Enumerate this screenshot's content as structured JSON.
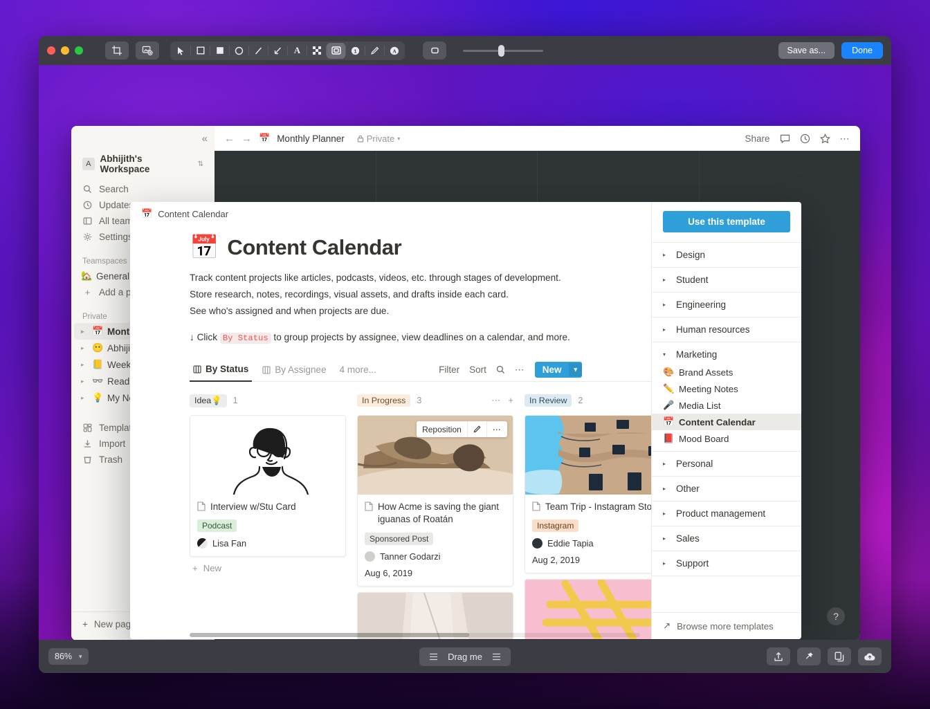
{
  "editor": {
    "toolbar": {
      "crop_label": "crop-tool",
      "annotate_label": "image-annotate-tool",
      "tools": [
        {
          "name": "cursor-tool",
          "glyph": "cursor"
        },
        {
          "name": "rectangle-outline-tool",
          "glyph": "rect-outline"
        },
        {
          "name": "rectangle-filled-tool",
          "glyph": "rect-filled"
        },
        {
          "name": "ellipse-tool",
          "glyph": "ellipse"
        },
        {
          "name": "line-tool",
          "glyph": "line"
        },
        {
          "name": "arrow-tool",
          "glyph": "arrow"
        },
        {
          "name": "text-tool",
          "glyph": "A"
        },
        {
          "name": "pixelate-tool",
          "glyph": "pixelate"
        },
        {
          "name": "shadow-tool",
          "glyph": "shadow"
        },
        {
          "name": "counter-tool",
          "glyph": "1"
        },
        {
          "name": "highlighter-tool",
          "glyph": "pen"
        },
        {
          "name": "blur-text-tool",
          "glyph": "blurA"
        }
      ],
      "shape_style_label": "shape-style",
      "save_as_label": "Save as...",
      "done_label": "Done"
    },
    "bottom": {
      "zoom_level": "86%",
      "drag_label": "Drag me",
      "actions": [
        {
          "name": "share-button",
          "glyph": "share"
        },
        {
          "name": "pin-button",
          "glyph": "pin"
        },
        {
          "name": "copy-button",
          "glyph": "copy"
        },
        {
          "name": "upload-cloud-button",
          "glyph": "cloud"
        }
      ]
    }
  },
  "notion": {
    "sidebar": {
      "workspace": {
        "badge": "A",
        "name": "Abhijith's Workspace"
      },
      "items": [
        {
          "icon": "search-icon",
          "label": "Search"
        },
        {
          "icon": "updates-icon",
          "label": "Updates"
        },
        {
          "icon": "all-teams-icon",
          "label": "All teams"
        },
        {
          "icon": "settings-icon",
          "label": "Settings"
        }
      ],
      "teamspaces_label": "Teamspaces",
      "teamspaces": [
        {
          "emoji": "🏡",
          "label": "General"
        }
      ],
      "add_page_label": "Add a page",
      "private_label": "Private",
      "private_pages": [
        {
          "emoji": "📅",
          "label": "Monthly Planner",
          "active": true
        },
        {
          "emoji": "😶",
          "label": "Abhijith's ...",
          "active": false
        },
        {
          "emoji": "📒",
          "label": "Weekly Age...",
          "active": false
        },
        {
          "emoji": "👓",
          "label": "Reading Li...",
          "active": false
        },
        {
          "emoji": "💡",
          "label": "My Notes",
          "active": false
        }
      ],
      "footer_items": [
        {
          "icon": "templates-icon",
          "label": "Templates"
        },
        {
          "icon": "import-icon",
          "label": "Import"
        },
        {
          "icon": "trash-icon",
          "label": "Trash"
        }
      ],
      "new_page_label": "New page"
    },
    "topbar": {
      "breadcrumb_emoji": "📅",
      "breadcrumb_title": "Monthly Planner",
      "privacy_label": "Private",
      "share_label": "Share",
      "icons": [
        {
          "name": "comment-icon"
        },
        {
          "name": "history-icon"
        },
        {
          "name": "favorite-star-icon"
        },
        {
          "name": "more-options-icon"
        }
      ]
    },
    "help_label": "?"
  },
  "template_modal": {
    "preview_header": {
      "emoji": "📅",
      "label": "Content Calendar"
    },
    "page": {
      "emoji": "📅",
      "title": "Content Calendar",
      "desc_line1": "Track content projects like articles, podcasts, videos, etc. through stages of development.",
      "desc_line2": "Store research, notes, recordings, visual assets, and drafts inside each card.",
      "desc_line3": "See who's assigned and when projects are due.",
      "hint_prefix": "↓ Click",
      "hint_code": "By Status",
      "hint_suffix": "to group projects by assignee, view deadlines on a calendar, and more."
    },
    "db_toolbar": {
      "tabs": [
        {
          "label": "By Status",
          "active": true
        },
        {
          "label": "By Assignee",
          "active": false
        }
      ],
      "more_views": "4 more...",
      "filter_label": "Filter",
      "sort_label": "Sort",
      "search_icon": "search-icon",
      "more_icon": "more-options-icon",
      "new_label": "New"
    },
    "board": {
      "columns": [
        {
          "status": "Idea",
          "status_emoji": "💡",
          "chip_class": "chip-idea",
          "count": "1",
          "new_label": "New",
          "cards": [
            {
              "title": "Interview w/Stu Card",
              "tag": "Podcast",
              "tag_class": "tag-green",
              "person": "Lisa Fan",
              "date": "",
              "image": "illustration-man-glasses"
            }
          ]
        },
        {
          "status": "In Progress",
          "status_emoji": "",
          "chip_class": "chip-prog",
          "count": "3",
          "new_label": "",
          "cards": [
            {
              "title": "How Acme is saving the giant iguanas of Roatán",
              "tag": "Sponsored Post",
              "tag_class": "tag-gray",
              "person": "Tanner Godarzi",
              "date": "Aug 6, 2019",
              "image": "photo-iguanas",
              "reposition_label": "Reposition"
            },
            {
              "title": "",
              "tag": "",
              "tag_class": "",
              "person": "",
              "date": "",
              "image": "photo-paper-texture"
            }
          ]
        },
        {
          "status": "In Review",
          "status_emoji": "",
          "chip_class": "chip-rev",
          "count": "2",
          "new_label": "",
          "cards": [
            {
              "title": "Team Trip - Instagram Stor",
              "tag": "Instagram",
              "tag_class": "tag-orange",
              "person": "Eddie Tapia",
              "date": "Aug 2, 2019",
              "image": "photo-gaudi-building"
            },
            {
              "title": "",
              "tag": "",
              "tag_class": "",
              "person": "",
              "date": "",
              "image": "photo-pink-sticks"
            }
          ]
        }
      ]
    },
    "side": {
      "use_template_label": "Use this template",
      "categories": [
        {
          "label": "Design",
          "open": false,
          "items": []
        },
        {
          "label": "Student",
          "open": false,
          "items": []
        },
        {
          "label": "Engineering",
          "open": false,
          "items": []
        },
        {
          "label": "Human resources",
          "open": false,
          "items": []
        },
        {
          "label": "Marketing",
          "open": true,
          "items": [
            {
              "emoji": "🎨",
              "label": "Brand Assets",
              "active": false
            },
            {
              "emoji": "✏️",
              "label": "Meeting Notes",
              "active": false
            },
            {
              "emoji": "🎤",
              "label": "Media List",
              "active": false
            },
            {
              "emoji": "📅",
              "label": "Content Calendar",
              "active": true
            },
            {
              "emoji": "📕",
              "label": "Mood Board",
              "active": false
            }
          ]
        },
        {
          "label": "Personal",
          "open": false,
          "items": []
        },
        {
          "label": "Other",
          "open": false,
          "items": []
        },
        {
          "label": "Product management",
          "open": false,
          "items": []
        },
        {
          "label": "Sales",
          "open": false,
          "items": []
        },
        {
          "label": "Support",
          "open": false,
          "items": []
        }
      ],
      "browse_more_label": "Browse more templates"
    }
  },
  "colors": {
    "accent_blue": "#2f9fd9",
    "done_blue": "#1a84ff",
    "notion_sidebar": "#f7f6f3",
    "notion_dark_canvas": "#2f3437"
  }
}
